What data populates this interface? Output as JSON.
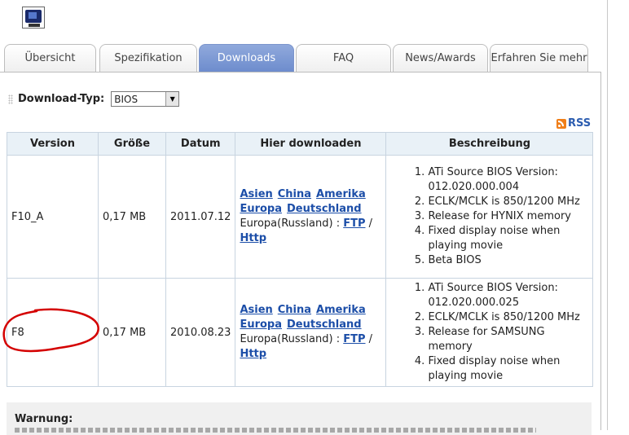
{
  "tabs": [
    {
      "label": "Übersicht",
      "active": false
    },
    {
      "label": "Spezifikation",
      "active": false
    },
    {
      "label": "Downloads",
      "active": true
    },
    {
      "label": "FAQ",
      "active": false
    },
    {
      "label": "News/Awards",
      "active": false
    },
    {
      "label": "Erfahren Sie mehr",
      "active": false
    }
  ],
  "download_type": {
    "label": "Download-Typ:",
    "selected": "BIOS"
  },
  "rss": {
    "label": "RSS"
  },
  "table": {
    "headers": [
      "Version",
      "Größe",
      "Datum",
      "Hier downloaden",
      "Beschreibung"
    ],
    "rows": [
      {
        "version": "F10_A",
        "size": "0,17 MB",
        "date": "2011.07.12",
        "links": {
          "asia": "Asien",
          "china": "China",
          "america": "Amerika",
          "europe": "Europa",
          "germany": "Deutschland",
          "russia_prefix": "Europa(Russland) : ",
          "ftp": "FTP",
          "sep": " / ",
          "http": "Http"
        },
        "description": [
          "ATi Source BIOS Version: 012.020.000.004",
          "ECLK/MCLK is 850/1200 MHz",
          "Release for HYNIX memory",
          "Fixed display noise when playing movie",
          "Beta BIOS"
        ]
      },
      {
        "version": "F8",
        "size": "0,17 MB",
        "date": "2010.08.23",
        "links": {
          "asia": "Asien",
          "china": "China",
          "america": "Amerika",
          "europe": "Europa",
          "germany": "Deutschland",
          "russia_prefix": "Europa(Russland) : ",
          "ftp": "FTP",
          "sep": " / ",
          "http": "Http"
        },
        "description": [
          "ATi Source BIOS Version: 012.020.000.025",
          "ECLK/MCLK is 850/1200 MHz",
          "Release for SAMSUNG memory",
          "Fixed display noise when playing movie"
        ]
      }
    ]
  },
  "warning": {
    "title": "Warnung:"
  },
  "colors": {
    "active_tab": "#7b97d2",
    "header_bg": "#e9f1f7",
    "link": "#1c4ea8",
    "annotation": "#d40000"
  }
}
